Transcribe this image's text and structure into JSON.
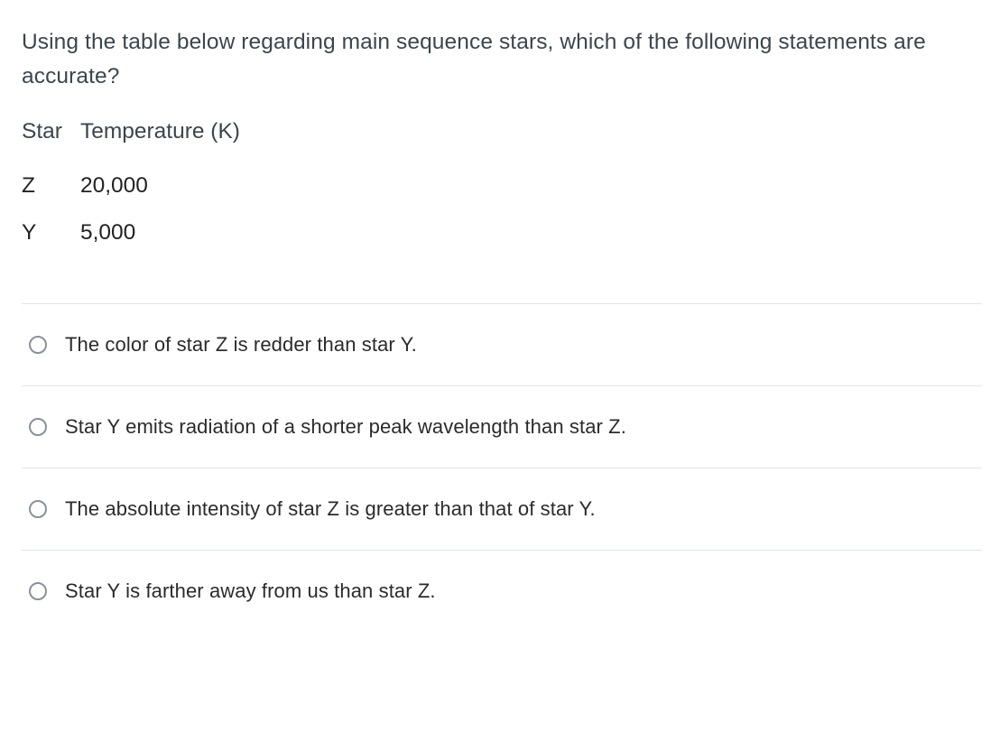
{
  "question": "Using the table below regarding main sequence stars, which of the following statements are accurate?",
  "table": {
    "headers": [
      "Star",
      "Temperature (K)"
    ],
    "rows": [
      {
        "star": "Z",
        "temp": "20,000"
      },
      {
        "star": "Y",
        "temp": "5,000"
      }
    ]
  },
  "options": [
    "The color of star Z is redder than star Y.",
    "Star Y emits radiation of a shorter peak wavelength than star Z.",
    "The absolute intensity of star Z is greater than that of star Y.",
    "Star Y is farther away from us than star Z."
  ]
}
